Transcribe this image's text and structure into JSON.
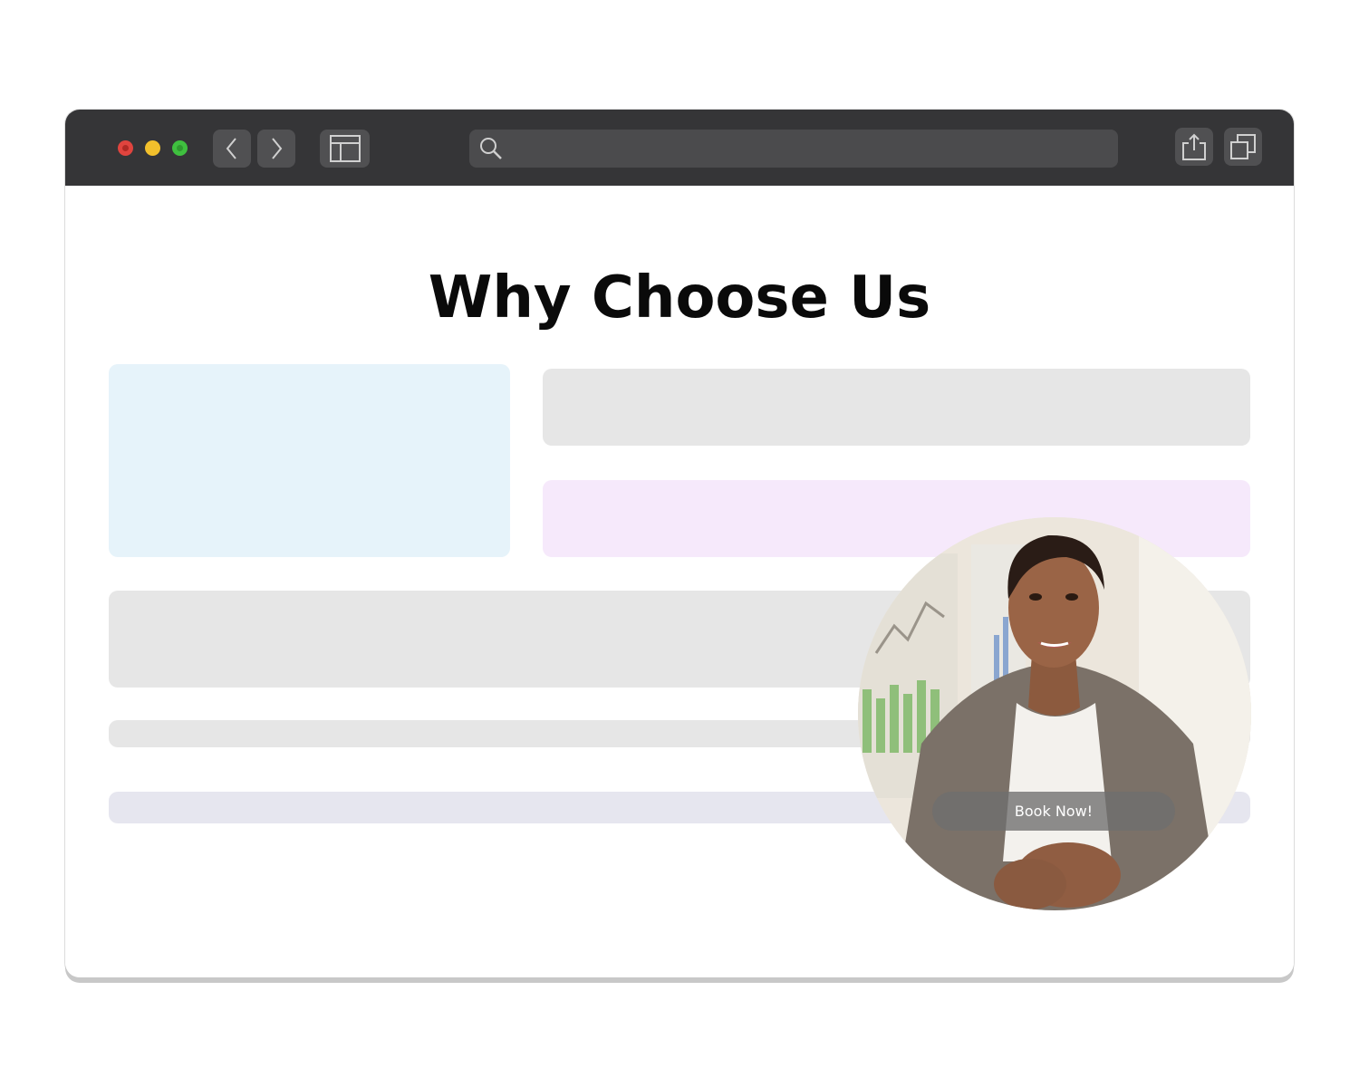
{
  "browser": {
    "search": {
      "value": "",
      "placeholder": ""
    },
    "icons": {
      "back": "chevron-left-icon",
      "forward": "chevron-right-icon",
      "sidebar": "sidebar-icon",
      "search": "search-icon",
      "share": "share-icon",
      "tabs": "tabs-icon"
    }
  },
  "page": {
    "title": "Why Choose Us"
  },
  "video_widget": {
    "cta_label": "Book Now!"
  },
  "colors": {
    "toolbar": "#353537",
    "hero_block": "#e6f3fa",
    "gray_block": "#e6e6e6",
    "pink_block": "#f6e9fb",
    "lavender_block": "#e6e6ef"
  }
}
